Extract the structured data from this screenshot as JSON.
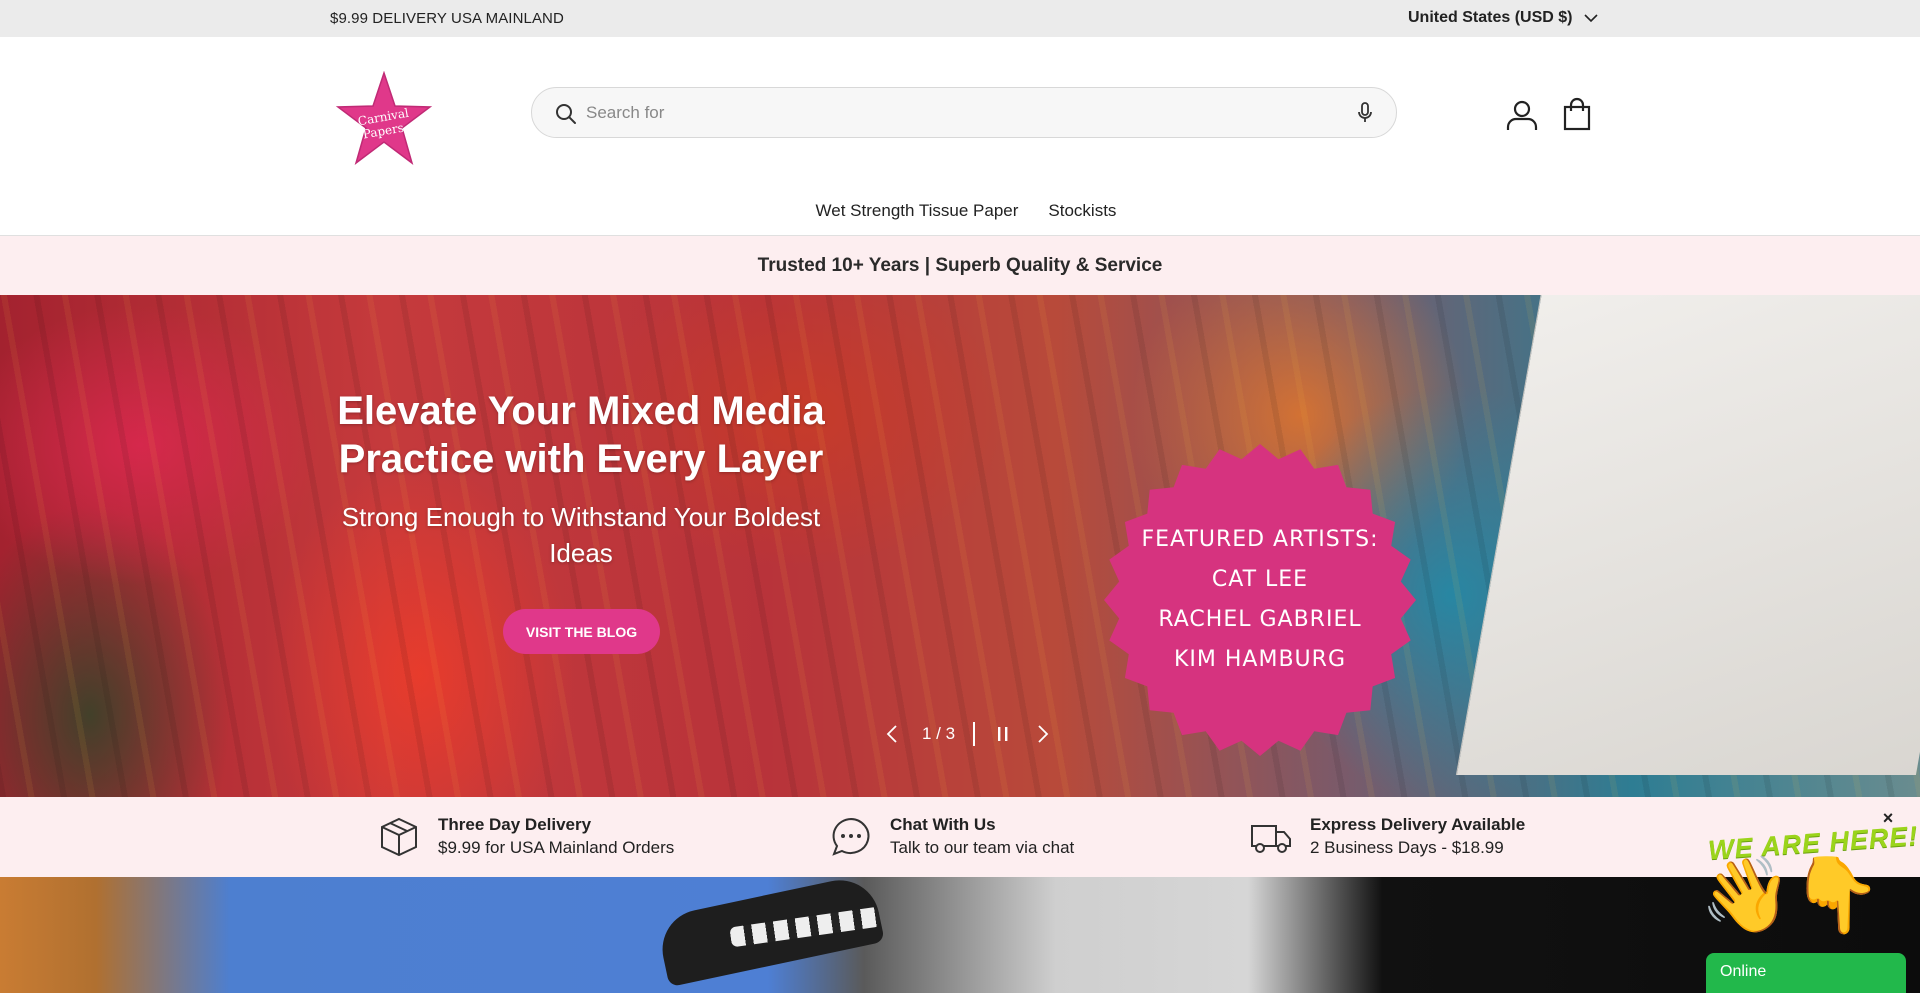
{
  "announcement": {
    "text": "$9.99 DELIVERY USA MAINLAND"
  },
  "country": {
    "selected": "United States (USD $)"
  },
  "logo": {
    "line1": "Carnival",
    "line2": "Papers"
  },
  "search": {
    "placeholder": "Search for",
    "value": ""
  },
  "nav": {
    "items": [
      {
        "label": "Wet Strength Tissue Paper"
      },
      {
        "label": "Stockists"
      }
    ]
  },
  "trust_bar": {
    "text": "Trusted 10+ Years | Superb Quality & Service"
  },
  "hero": {
    "title": "Elevate Your Mixed Media Practice with Every Layer",
    "subtitle": "Strong Enough to Withstand Your Boldest Ideas",
    "button_label": "VISIT THE BLOG",
    "badge_lines": [
      "FEATURED ARTISTS:",
      "CAT LEE",
      "RACHEL GABRIEL",
      "KIM HAMBURG"
    ],
    "badge_color": "#d6337f",
    "slide_counter": "1 / 3"
  },
  "features": [
    {
      "icon": "box-icon",
      "title": "Three Day Delivery",
      "desc": "$9.99 for USA Mainland Orders"
    },
    {
      "icon": "chat-icon",
      "title": "Chat With Us",
      "desc": "Talk to our team via chat"
    },
    {
      "icon": "truck-icon",
      "title": "Express Delivery Available",
      "desc": "2 Business Days - $18.99"
    }
  ],
  "chat_widget": {
    "heading": "WE ARE HERE!",
    "close_label": "×",
    "status": "Online",
    "status_color": "#22b84b",
    "heading_color": "#9bd41b"
  },
  "colors": {
    "accent": "#e0388a",
    "trust_bg": "#fdeef0",
    "announce_bg": "#ebebeb"
  }
}
